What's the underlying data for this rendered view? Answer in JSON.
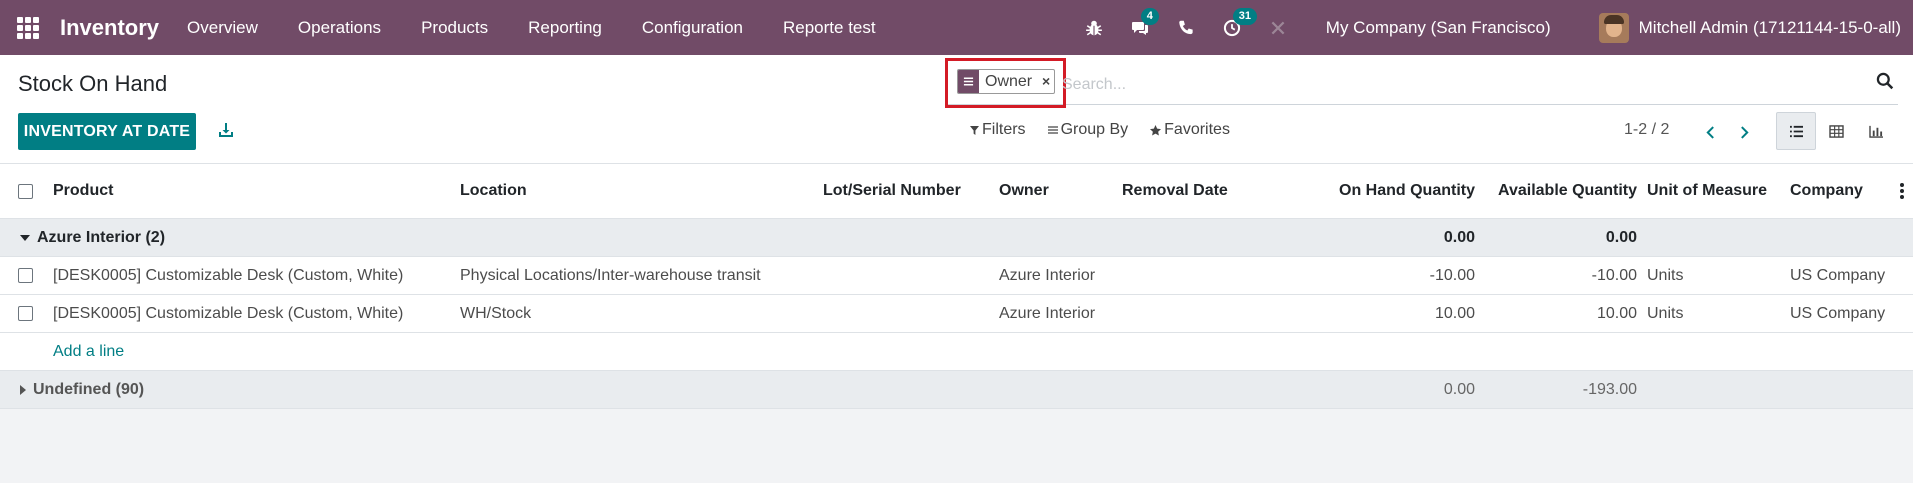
{
  "navbar": {
    "app_name": "Inventory",
    "menu": [
      "Overview",
      "Operations",
      "Products",
      "Reporting",
      "Configuration",
      "Reporte test"
    ],
    "messages_count": "4",
    "activities_count": "31",
    "company": "My Company (San Francisco)",
    "user": "Mitchell Admin (17121144-15-0-all)"
  },
  "control": {
    "title": "Stock On Hand",
    "primary_button": "INVENTORY AT DATE",
    "search": {
      "facet_label": "Owner",
      "placeholder": "Search..."
    },
    "filters_label": "Filters",
    "groupby_label": "Group By",
    "favorites_label": "Favorites",
    "pager": "1-2 / 2"
  },
  "table": {
    "headers": {
      "product": "Product",
      "location": "Location",
      "lot": "Lot/Serial Number",
      "owner": "Owner",
      "removal": "Removal Date",
      "on_hand": "On Hand Quantity",
      "available": "Available Quantity",
      "uom": "Unit of Measure",
      "company": "Company"
    },
    "group1": {
      "label": "Azure Interior (2)",
      "on_hand": "0.00",
      "available": "0.00"
    },
    "rows": [
      {
        "product": "[DESK0005] Customizable Desk (Custom, White)",
        "location": "Physical Locations/Inter-warehouse transit",
        "owner": "Azure Interior",
        "on_hand": "-10.00",
        "available": "-10.00",
        "uom": "Units",
        "company": "US Company"
      },
      {
        "product": "[DESK0005] Customizable Desk (Custom, White)",
        "location": "WH/Stock",
        "owner": "Azure Interior",
        "on_hand": "10.00",
        "available": "10.00",
        "uom": "Units",
        "company": "US Company"
      }
    ],
    "add_line": "Add a line",
    "group2": {
      "label": "Undefined (90)",
      "on_hand": "0.00",
      "available": "-193.00"
    }
  },
  "colors": {
    "navbar": "#714b67",
    "primary": "#017e84",
    "highlight": "#d31b26"
  }
}
